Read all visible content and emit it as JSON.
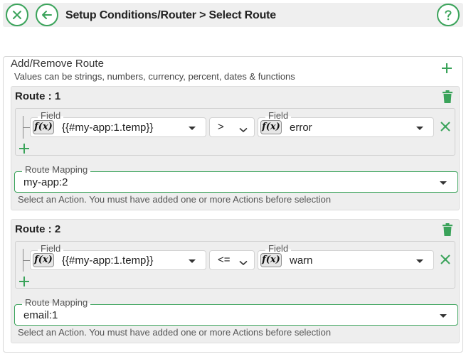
{
  "header": {
    "title": "Setup Conditions/Router > Select Route",
    "close_icon": "close-circle-icon",
    "back_icon": "arrow-left-circle-icon",
    "help_icon": "question-circle-icon"
  },
  "panel": {
    "title": "Add/Remove Route",
    "subtitle": "Values can be strings, numbers, currency, percent, dates & functions"
  },
  "colors": {
    "accent": "#3aa35a",
    "card_bg": "#eeeeee",
    "header_bg": "#efefef"
  },
  "routes": [
    {
      "title": "Route : 1",
      "condition": {
        "left_label": "Field",
        "left_fx": "f(x)",
        "left_value": "{{#my-app:1.temp}}",
        "operator": ">",
        "right_label": "Field",
        "right_fx": "f(x)",
        "right_value": "error"
      },
      "mapping_label": "Route Mapping",
      "mapping_value": "my-app:2",
      "helper": "Select an Action. You must have added one or more Actions before selection"
    },
    {
      "title": "Route : 2",
      "condition": {
        "left_label": "Field",
        "left_fx": "f(x)",
        "left_value": "{{#my-app:1.temp}}",
        "operator": "<=",
        "right_label": "Field",
        "right_fx": "f(x)",
        "right_value": "warn"
      },
      "mapping_label": "Route Mapping",
      "mapping_value": "email:1",
      "helper": "Select an Action. You must have added one or more Actions before selection"
    }
  ]
}
